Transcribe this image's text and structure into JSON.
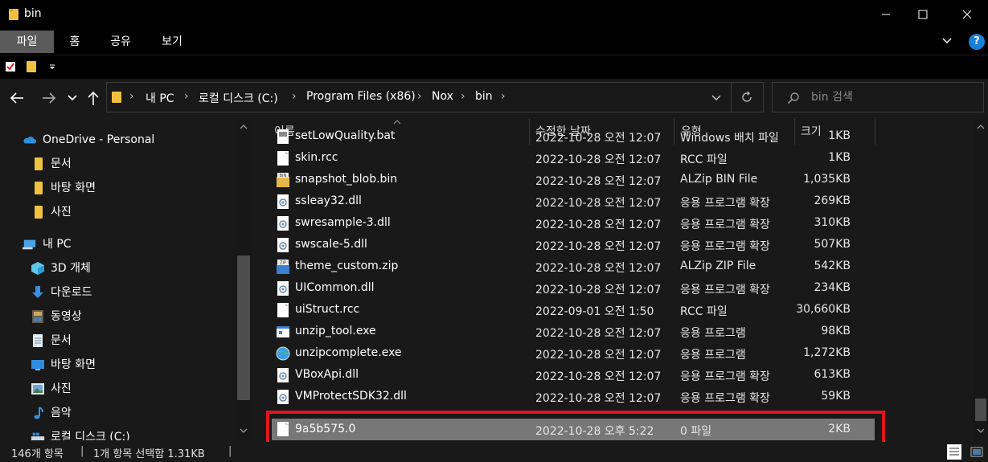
{
  "window": {
    "title": "bin"
  },
  "ribbon": {
    "tabs": [
      {
        "label": "파일",
        "active": true
      },
      {
        "label": "홈",
        "active": false
      },
      {
        "label": "공유",
        "active": false
      },
      {
        "label": "보기",
        "active": false
      }
    ],
    "help_label": "?"
  },
  "address": {
    "crumbs": [
      "내 PC",
      "로컬 디스크 (C:)",
      "Program Files (x86)",
      "Nox",
      "bin"
    ]
  },
  "search": {
    "placeholder": "bin 검색"
  },
  "navpane": {
    "items": [
      {
        "label": "OneDrive - Personal",
        "icon": "cloud-icon"
      },
      {
        "label": "문서",
        "icon": "folder-icon"
      },
      {
        "label": "바탕 화면",
        "icon": "folder-icon"
      },
      {
        "label": "사진",
        "icon": "folder-icon"
      },
      {
        "label": "내 PC",
        "icon": "computer-icon"
      },
      {
        "label": "3D 개체",
        "icon": "cube-icon"
      },
      {
        "label": "다운로드",
        "icon": "download-icon"
      },
      {
        "label": "동영상",
        "icon": "video-icon"
      },
      {
        "label": "문서",
        "icon": "document-icon"
      },
      {
        "label": "바탕 화면",
        "icon": "desktop-icon"
      },
      {
        "label": "사진",
        "icon": "picture-icon"
      },
      {
        "label": "음악",
        "icon": "music-icon"
      },
      {
        "label": "로컬 디스크 (C:)",
        "icon": "drive-icon"
      }
    ]
  },
  "columns": {
    "name": "이름",
    "date": "수정한 날짜",
    "type": "유형",
    "size": "크기"
  },
  "files": [
    {
      "name": "setLowQuality.bat",
      "date": "2022-10-28 오전 12:07",
      "type": "Windows 배치 파일",
      "size": "1KB",
      "icon": "batch-file-icon"
    },
    {
      "name": "skin.rcc",
      "date": "2022-10-28 오전 12:07",
      "type": "RCC 파일",
      "size": "1KB",
      "icon": "file-icon"
    },
    {
      "name": "snapshot_blob.bin",
      "date": "2022-10-28 오전 12:07",
      "type": "ALZip BIN File",
      "size": "1,035KB",
      "icon": "bin-file-icon"
    },
    {
      "name": "ssleay32.dll",
      "date": "2022-10-28 오전 12:07",
      "type": "응용 프로그램 확장",
      "size": "269KB",
      "icon": "dll-file-icon"
    },
    {
      "name": "swresample-3.dll",
      "date": "2022-10-28 오전 12:07",
      "type": "응용 프로그램 확장",
      "size": "310KB",
      "icon": "dll-file-icon"
    },
    {
      "name": "swscale-5.dll",
      "date": "2022-10-28 오전 12:07",
      "type": "응용 프로그램 확장",
      "size": "507KB",
      "icon": "dll-file-icon"
    },
    {
      "name": "theme_custom.zip",
      "date": "2022-10-28 오전 12:07",
      "type": "ALZip ZIP File",
      "size": "542KB",
      "icon": "zip-file-icon"
    },
    {
      "name": "UICommon.dll",
      "date": "2022-10-28 오전 12:07",
      "type": "응용 프로그램 확장",
      "size": "234KB",
      "icon": "dll-file-icon"
    },
    {
      "name": "uiStruct.rcc",
      "date": "2022-09-01 오전 1:50",
      "type": "RCC 파일",
      "size": "30,660KB",
      "icon": "file-icon"
    },
    {
      "name": "unzip_tool.exe",
      "date": "2022-10-28 오전 12:07",
      "type": "응용 프로그램",
      "size": "98KB",
      "icon": "exe-file-icon"
    },
    {
      "name": "unzipcomplete.exe",
      "date": "2022-10-28 오전 12:07",
      "type": "응용 프로그램",
      "size": "1,272KB",
      "icon": "globe-exe-icon"
    },
    {
      "name": "VBoxApi.dll",
      "date": "2022-10-28 오전 12:07",
      "type": "응용 프로그램 확장",
      "size": "613KB",
      "icon": "dll-file-icon"
    },
    {
      "name": "VMProtectSDK32.dll",
      "date": "2022-10-28 오전 12:07",
      "type": "응용 프로그램 확장",
      "size": "59KB",
      "icon": "dll-file-icon"
    },
    {
      "name": "9a5b575.0",
      "date": "2022-10-28 오후 5:22",
      "type": "0 파일",
      "size": "2KB",
      "icon": "file-icon",
      "selected": true
    }
  ],
  "status": {
    "item_count": "146개 항목",
    "selection": "1개 항목 선택함 1.31KB"
  },
  "colors": {
    "highlight": "#e0161e",
    "selected_row": "#777777",
    "help_blue": "#1a7fd6"
  }
}
